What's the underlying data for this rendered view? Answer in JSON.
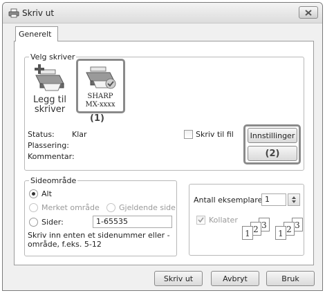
{
  "window": {
    "title": "Skriv ut"
  },
  "tabs": [
    {
      "label": "Generelt"
    }
  ],
  "select_printer": {
    "group_label": "Velg skriver",
    "add_printer": {
      "line1": "Legg til",
      "line2": "skriver"
    },
    "selected_printer": {
      "line1": "SHARP",
      "line2": "MX-xxxx"
    },
    "callout_1": "(1)"
  },
  "printer_info": {
    "status_label": "Status:",
    "status_value": "Klar",
    "location_label": "Plassering:",
    "comment_label": "Kommentar:"
  },
  "print_to_file_label": "Skriv til fil",
  "settings_button": "Innstillinger",
  "callout_2": "(2)",
  "page_range": {
    "group_label": "Sideområde",
    "all_label": "Alt",
    "selection_label": "Merket område",
    "current_page_label": "Gjeldende side",
    "pages_label": "Sider:",
    "pages_value": "1-65535",
    "hint": "Skriv inn enten et sidenummer eller -område, f.eks. 5-12"
  },
  "copies": {
    "label": "Antall eksemplarer:",
    "value": "1",
    "collate_label": "Kollater"
  },
  "buttons": {
    "print": "Skriv ut",
    "cancel": "Avbryt",
    "apply": "Bruk"
  }
}
